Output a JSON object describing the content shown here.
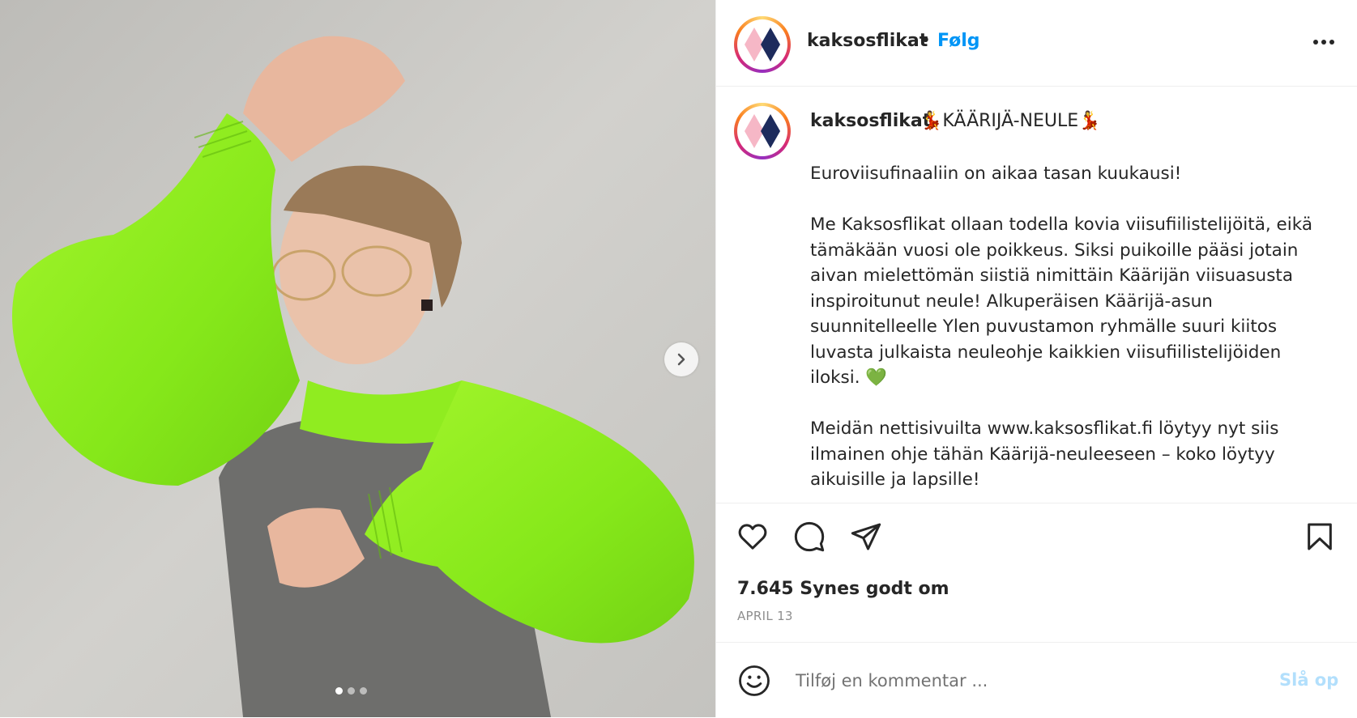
{
  "post": {
    "username": "kaksosflikat",
    "separator": "•",
    "follow_label": "Følg",
    "caption_title": "💃KÄÄRIJÄ-NEULE💃",
    "caption_body": "Euroviisufinaaliin on aikaa tasan kuukausi!\n\nMe Kaksosflikat ollaan todella kovia viisufiilistelijöitä, eikä tämäkään vuosi ole poikkeus. Siksi puikoille pääsi jotain aivan mielettömän siistiä nimittäin Käärijän viisuasusta inspiroitunut neule! Alkuperäisen Käärijä-asun suunnitelleelle Ylen puvustamon ryhmälle suuri kiitos luvasta julkaista neuleohje kaikkien viisufiilistelijöiden iloksi. 💚\n\nMeidän nettisivuilta www.kaksosflikat.fi löytyy nyt siis ilmainen ohje tähän Käärijä-neuleeseen – koko löytyy aikuisille ja lapsille!",
    "likes_text": "7.645 Synes godt om",
    "date_text": "APRIL 13",
    "carousel": {
      "total": 3,
      "active": 0
    }
  },
  "comment": {
    "placeholder": "Tilføj en kommentar ...",
    "post_label": "Slå op"
  },
  "icons": {
    "more": "more-horizontal-icon",
    "like": "heart-icon",
    "comment": "comment-icon",
    "share": "paper-plane-icon",
    "save": "bookmark-icon",
    "next": "chevron-right-icon",
    "emoji": "smiley-icon"
  },
  "colors": {
    "accent": "#0095f6",
    "post_disabled": "#b2dffc",
    "sweater": "#8df21a",
    "avatar_diamond_pink": "#f6b7c6",
    "avatar_diamond_navy": "#1d2b5c"
  }
}
